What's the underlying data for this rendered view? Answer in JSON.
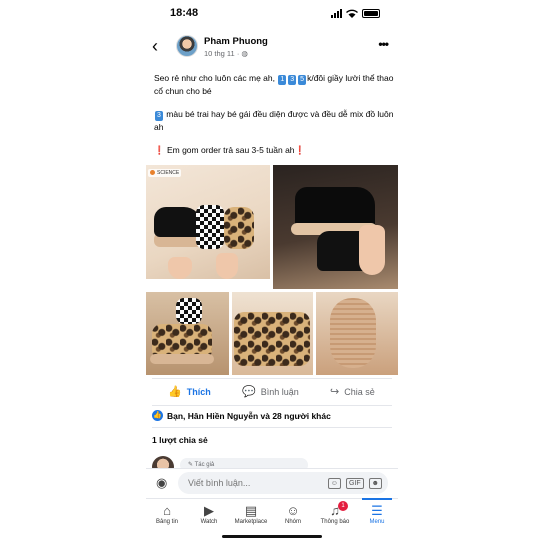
{
  "status_bar": {
    "time": "18:48"
  },
  "post": {
    "author": "Pham Phuong",
    "date": "10 thg 11",
    "visibility_icon": "globe-icon",
    "text_line1_a": "Seo rẻ như cho luôn các mẹ ah, ",
    "price_digits": [
      "1",
      "3",
      "5"
    ],
    "text_line1_b": "k/đôi giầy lười thể thao cổ chun cho bé",
    "text_line2_digit": "3",
    "text_line2": " màu bé trai hay bé gái đều diện được và đều dễ mix đồ luôn ah",
    "text_line3": "Em gom order trả sau 3-5 tuần ah",
    "exclaim": "❗",
    "image1_brand": "SCIENCE"
  },
  "actions": {
    "like": "Thích",
    "comment": "Bình luận",
    "share": "Chia sẻ"
  },
  "reactions_text": "Bạn, Hân Hiền Nguyễn và 28 người khác",
  "shares_text": "1 lượt chia sẻ",
  "reply_hint": "Tác giả",
  "comment_box": {
    "placeholder": "Viết bình luận...",
    "gif_label": "GIF"
  },
  "tabs": [
    {
      "label": "Bảng tin",
      "icon": "home-icon"
    },
    {
      "label": "Watch",
      "icon": "watch-icon"
    },
    {
      "label": "Marketplace",
      "icon": "marketplace-icon"
    },
    {
      "label": "Nhóm",
      "icon": "groups-icon"
    },
    {
      "label": "Thông báo",
      "icon": "bell-icon",
      "badge": "1"
    },
    {
      "label": "Menu",
      "icon": "menu-icon",
      "active": true
    }
  ],
  "colors": {
    "accent": "#1b74e4",
    "badge": "#e41e3f"
  }
}
